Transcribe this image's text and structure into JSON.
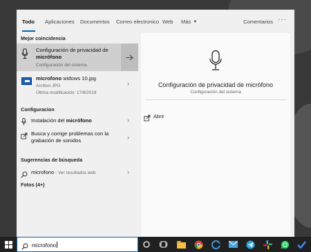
{
  "tabs": [
    {
      "label": "Todo",
      "active": true
    },
    {
      "label": "Aplicaciones"
    },
    {
      "label": "Documentos"
    },
    {
      "label": "Correo electronico"
    },
    {
      "label": "Web"
    },
    {
      "label": "Más"
    }
  ],
  "comments_label": "Comentarios",
  "more_icon": "ellipsis-icon",
  "sections": {
    "best_match": "Mejor coincidencia",
    "settings": "Configuracion",
    "suggestions": "Sugerencias de búsqueda",
    "photos": "Fotos (4+)"
  },
  "best_match": {
    "icon": "microphone-icon",
    "title_part1": "Configuración de privacidad de",
    "title_part2": "micrófono",
    "subtitle": "Configuración del sistema"
  },
  "file_result": {
    "icon": "image-file-icon",
    "name_bold": "microfono",
    "name_rest": " widows 10.jpg",
    "type": "Archivo JPG",
    "modified": "Última modificación: 17/6/2019"
  },
  "settings_items": [
    {
      "icon": "microphone-icon",
      "prefix": "Instalación del ",
      "bold": "micrófono",
      "line2": ""
    },
    {
      "icon": "troubleshoot-icon",
      "prefix": "Busca y corrige problemas con la",
      "bold": "",
      "line2": "grabación de sonidos"
    }
  ],
  "suggestion": {
    "icon": "search-icon",
    "text": "microfono",
    "suffix": " - Ver resultados web"
  },
  "preview": {
    "icon": "microphone-icon",
    "title": "Configuración de privacidad de micrófono",
    "subtitle": "Configuración del sistema",
    "action": "Abrir"
  },
  "taskbar": {
    "search_value": "microfono",
    "icons": [
      "windows-start-icon",
      "cortana-icon",
      "task-view-icon",
      "file-explorer-icon",
      "chrome-icon",
      "edge-icon",
      "mail-icon",
      "telegram-icon",
      "slack-icon",
      "whatsapp-icon",
      "todo-icon"
    ]
  },
  "colors": {
    "accent": "#0063b1",
    "selected_bg": "#cfcfcf",
    "panel_bg": "#f0f0f0",
    "taskbar_bg": "#202020"
  }
}
